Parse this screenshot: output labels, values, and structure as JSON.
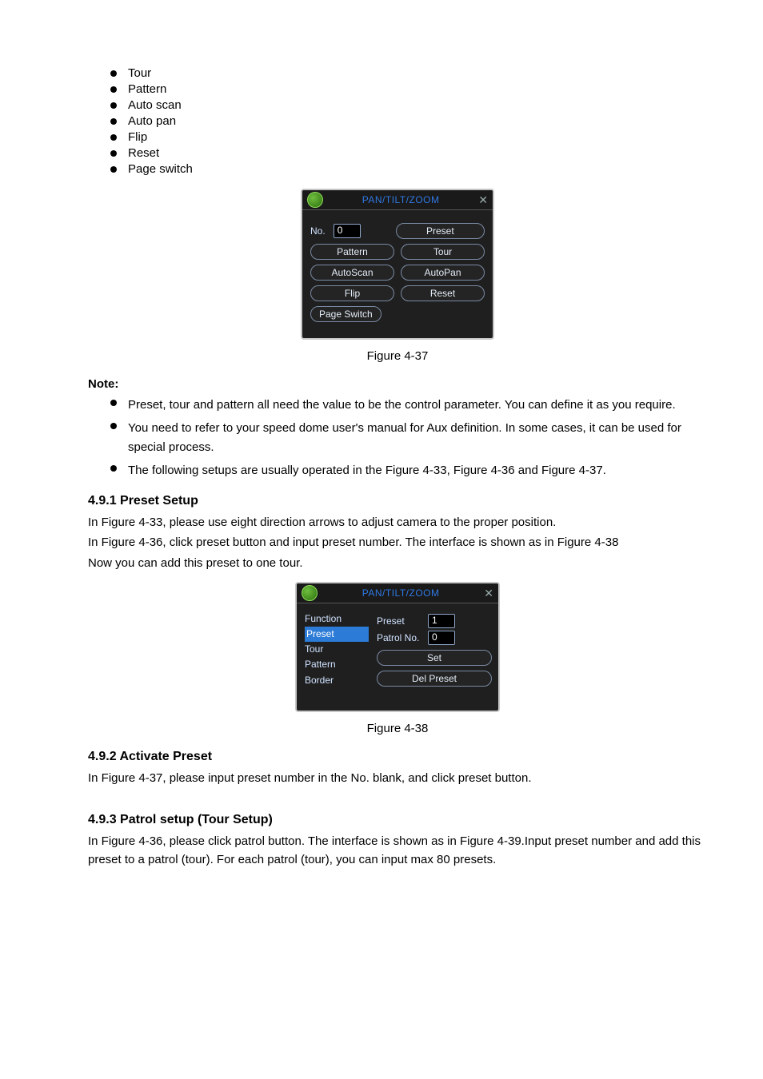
{
  "top_list": [
    "Tour",
    "Pattern",
    "Auto scan",
    "Auto pan",
    "Flip",
    "Reset",
    "Page switch"
  ],
  "ptz1": {
    "title": "PAN/TILT/ZOOM",
    "no_label": "No.",
    "no_value": "0",
    "buttons": {
      "preset": "Preset",
      "pattern": "Pattern",
      "tour": "Tour",
      "autoscan": "AutoScan",
      "autopan": "AutoPan",
      "flip": "Flip",
      "reset": "Reset",
      "page_switch": "Page Switch"
    }
  },
  "figure37": "Figure 4-37",
  "note_label": "Note:",
  "notes": [
    "Preset, tour and pattern all need the value to be the control parameter. You can define it as you require.",
    "You need to refer to your speed dome user's manual for Aux definition. In some cases, it can be used for special process.",
    "The following setups are usually operated in the Figure 4-33, Figure 4-36 and Figure 4-37."
  ],
  "h491": "4.9.1 Preset Setup",
  "p491a": "In Figure 4-33, please use eight direction arrows to adjust camera to the proper position.",
  "p491b": "In Figure 4-36, click preset button and input preset number. The interface is shown as in Figure 4-38",
  "p491c": "Now you can add this preset to one tour.",
  "ptz2": {
    "title": "PAN/TILT/ZOOM",
    "function_label": "Function",
    "function_items": [
      "Preset",
      "Tour",
      "Pattern",
      "Border"
    ],
    "preset_label": "Preset",
    "preset_value": "1",
    "patrol_label": "Patrol No.",
    "patrol_value": "0",
    "set_btn": "Set",
    "del_btn": "Del Preset"
  },
  "figure38": "Figure 4-38",
  "h492": "4.9.2 Activate Preset",
  "p492": "In Figure 4-37, please input preset number in the No. blank, and click preset button.",
  "h493": "4.9.3 Patrol setup (Tour Setup)",
  "p493": "In Figure 4-36, please click patrol button. The interface is shown as in Figure 4-39.Input preset number and add this preset to a patrol (tour). For each patrol (tour), you can input max 80 presets."
}
